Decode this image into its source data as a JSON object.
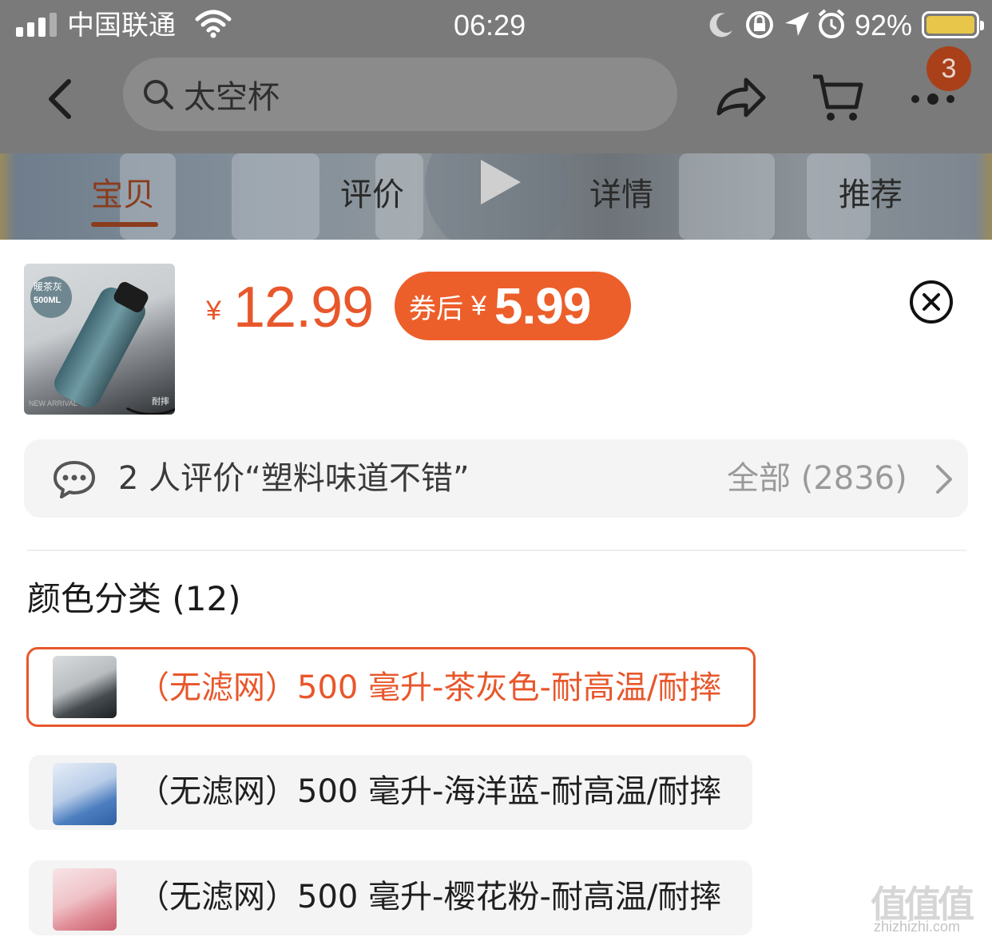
{
  "status_bar": {
    "carrier": "中国联通",
    "time": "06:29",
    "battery": "92%"
  },
  "nav": {
    "search_text": "太空杯",
    "cart_badge": "3"
  },
  "tabs": [
    {
      "label": "宝贝",
      "active": true
    },
    {
      "label": "评价",
      "active": false
    },
    {
      "label": "详情",
      "active": false
    },
    {
      "label": "推荐",
      "active": false
    }
  ],
  "product": {
    "thumb_tag_line1": "暖茶灰",
    "thumb_tag_line2": "500ML",
    "thumb_note": "耐摔",
    "thumb_corner": "NEW ARRIVAL",
    "price_currency": "¥",
    "price": "12.99",
    "coupon_label": "券后",
    "coupon_currency": "¥",
    "coupon_price": "5.99"
  },
  "review": {
    "text": "2 人评价“塑料味道不错”",
    "all": "全部 (2836)"
  },
  "color_section": {
    "title": "颜色分类 (12)",
    "options": [
      {
        "label": "（无滤网）500 毫升-茶灰色-耐高温/耐摔",
        "selected": true
      },
      {
        "label": "（无滤网）500 毫升-海洋蓝-耐高温/耐摔",
        "selected": false
      },
      {
        "label": "（无滤网）500 毫升-樱花粉-耐高温/耐摔",
        "selected": false
      }
    ]
  },
  "watermark": {
    "text": "值值值",
    "url": "zhizhizhi.com"
  },
  "colors": {
    "accent": "#e8572b",
    "coupon_bg": "#ec5f2b",
    "overlay": "#7a7a7a"
  }
}
